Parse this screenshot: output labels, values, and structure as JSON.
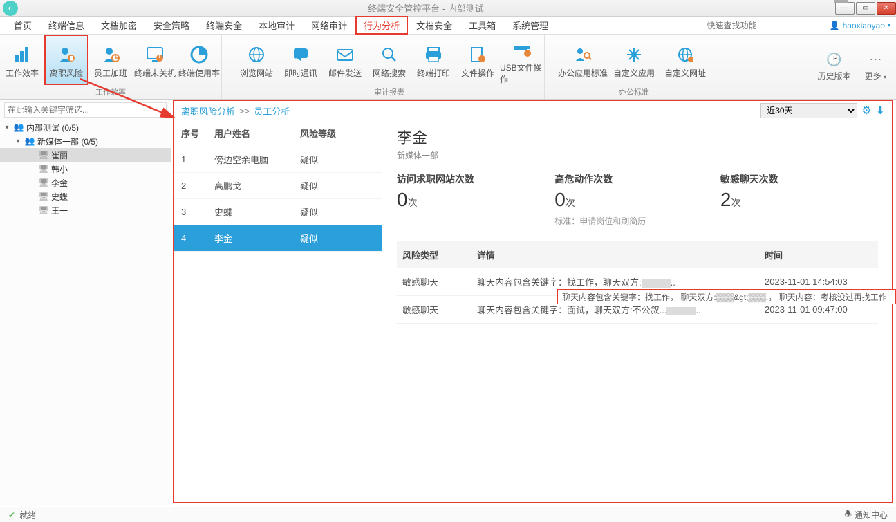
{
  "window": {
    "title": "终端安全管控平台 - 内部测试"
  },
  "menu": {
    "items": [
      "首页",
      "终端信息",
      "文档加密",
      "安全策略",
      "终端安全",
      "本地审计",
      "网络审计",
      "行为分析",
      "文档安全",
      "工具箱",
      "系统管理"
    ],
    "active_index": 7,
    "search_placeholder": "快速查找功能",
    "user": "haoxiaoyao"
  },
  "ribbon": {
    "group1": {
      "label": "工作效率",
      "items": [
        "工作效率",
        "离职风险",
        "员工加班",
        "终端未关机",
        "终端使用率"
      ],
      "highlighted_index": 1
    },
    "group2": {
      "label": "审计报表",
      "items": [
        "浏览网站",
        "即时通讯",
        "邮件发送",
        "网络搜索",
        "终端打印",
        "文件操作",
        "USB文件操作"
      ]
    },
    "group3": {
      "label": "办公标准",
      "items": [
        "办公应用标准",
        "自定义应用",
        "自定义网址"
      ]
    },
    "right": {
      "history": "历史版本",
      "more": "更多"
    }
  },
  "sidebar": {
    "filter_placeholder": "在此输入关键字筛选...",
    "nodes": [
      {
        "lvl": 0,
        "expand": "▾",
        "ic": "👥",
        "icClass": "users-ic",
        "label": "内部测试 (0/5)"
      },
      {
        "lvl": 1,
        "expand": "▾",
        "ic": "👥",
        "icClass": "users-ic",
        "label": "新媒体一部 (0/5)"
      },
      {
        "lvl": 2,
        "expand": "",
        "ic": "🖥",
        "icClass": "pc-ic",
        "label": "崔丽",
        "sel": true
      },
      {
        "lvl": 2,
        "expand": "",
        "ic": "🖥",
        "icClass": "pc-ic",
        "label": "韩小"
      },
      {
        "lvl": 2,
        "expand": "",
        "ic": "🖥",
        "icClass": "pc-ic",
        "label": "李金"
      },
      {
        "lvl": 2,
        "expand": "",
        "ic": "🖥",
        "icClass": "pc-ic",
        "label": "史蝶"
      },
      {
        "lvl": 2,
        "expand": "",
        "ic": "🖥",
        "icClass": "pc-ic",
        "label": "王一"
      }
    ]
  },
  "crumb": {
    "a": "离职风险分析",
    "sep": ">>",
    "b": "员工分析",
    "range": "近30天"
  },
  "userlist": {
    "head": {
      "idx": "序号",
      "name": "用户姓名",
      "lvl": "风险等级"
    },
    "rows": [
      {
        "idx": "1",
        "name": "傍边空余电脑",
        "lvl": "疑似"
      },
      {
        "idx": "2",
        "name": "高鹏戈",
        "lvl": "疑似"
      },
      {
        "idx": "3",
        "name": "史蝶",
        "lvl": "疑似"
      },
      {
        "idx": "4",
        "name": "李金",
        "lvl": "疑似",
        "sel": true
      }
    ]
  },
  "detail": {
    "name": "李金",
    "dept": "新媒体一部",
    "stats": [
      {
        "label": "访问求职网站次数",
        "val": "0",
        "unit": "次"
      },
      {
        "label": "高危动作次数",
        "val": "0",
        "unit": "次",
        "std": "标准：申请岗位和刷简历"
      },
      {
        "label": "敏感聊天次数",
        "val": "2",
        "unit": "次"
      }
    ],
    "evt_head": {
      "c1": "风险类型",
      "c2": "详情",
      "c3": "时间"
    },
    "evt_rows": [
      {
        "c1": "敏感聊天",
        "c2": "聊天内容包含关键字：找工作，聊天双方:",
        "c3": "2023-11-01 14:54:03"
      },
      {
        "c1": "敏感聊天",
        "c2": "聊天内容包含关键字：面试，聊天双方:不公叙...",
        "c3": "2023-11-01 09:47:00"
      }
    ]
  },
  "tooltip": "聊天内容包含关键字：找工作，  聊天双方:▒▒▒&gt;▒▒▒.，  聊天内容：考核没过再找工作",
  "status": {
    "ready": "就绪",
    "notif": "通知中心"
  }
}
